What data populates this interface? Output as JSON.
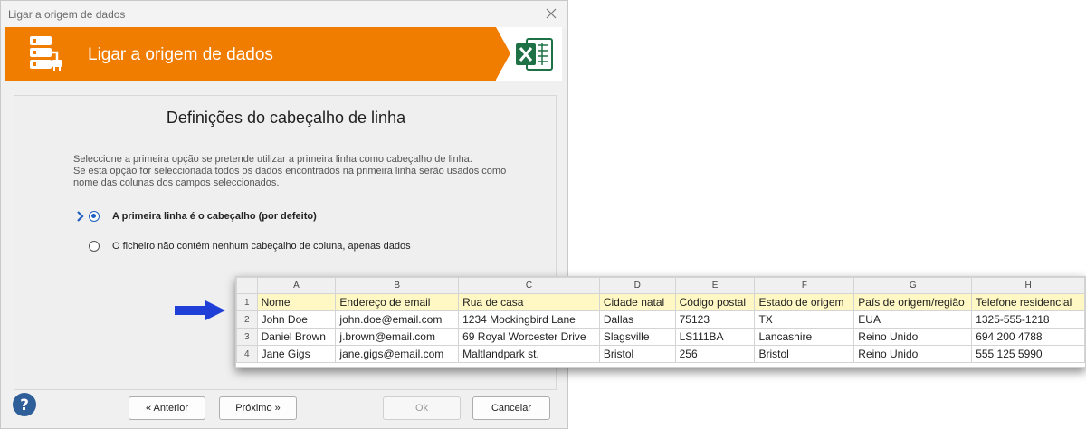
{
  "window": {
    "title": "Ligar a origem de dados",
    "banner_title": "Ligar a origem de dados",
    "accent": "#f07c00"
  },
  "content": {
    "heading": "Definições do cabeçalho de linha",
    "description": [
      "Seleccione a primeira opção se pretende utilizar a primeira linha como cabeçalho de linha.",
      "Se esta opção for seleccionada todos os dados encontrados na primeira linha serão usados como",
      "nome das colunas dos campos seleccionados."
    ],
    "options": [
      {
        "label": "A primeira linha é o cabeçalho (por defeito)",
        "selected": true
      },
      {
        "label": "O ficheiro não contém nenhum cabeçalho de coluna, apenas dados",
        "selected": false
      }
    ]
  },
  "buttons": {
    "previous": "« Anterior",
    "next": "Próximo »",
    "ok": "Ok",
    "cancel": "Cancelar"
  },
  "sheet": {
    "columns": [
      "A",
      "B",
      "C",
      "D",
      "E",
      "F",
      "G",
      "H"
    ],
    "row_numbers": [
      "1",
      "2",
      "3",
      "4"
    ],
    "rows": [
      [
        "Nome",
        "Endereço de email",
        "Rua de casa",
        "Cidade natal",
        "Código postal",
        "Estado de origem",
        "País de origem/região",
        "Telefone residencial"
      ],
      [
        "John Doe",
        "john.doe@email.com",
        "1234 Mockingbird Lane",
        "Dallas",
        "75123",
        "TX",
        "EUA",
        "1325-555-1218"
      ],
      [
        "Daniel Brown",
        "j.brown@email.com",
        "69 Royal Worcester Drive",
        "Slagsville",
        "LS111BA",
        "Lancashire",
        "Reino Unido",
        "694 200 4788"
      ],
      [
        "Jane Gigs",
        "jane.gigs@email.com",
        "Maltlandpark st.",
        "Bristol",
        "256",
        "Bristol",
        "Reino Unido",
        "555 125 5990"
      ]
    ],
    "header_highlight": "#fff8c4"
  },
  "icons": {
    "data_source": "database-plug-icon",
    "excel": "excel-icon",
    "help": "help-icon",
    "close": "close-icon",
    "arrow": "arrow-right-icon",
    "chevron": "chevron-right-icon"
  }
}
